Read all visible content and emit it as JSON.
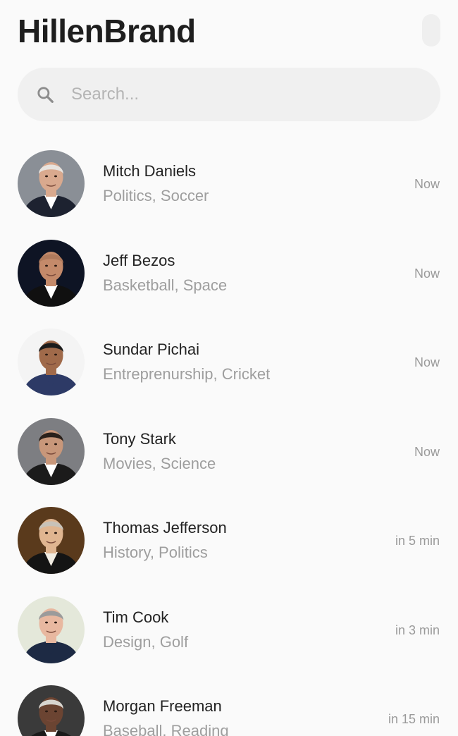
{
  "app": {
    "title": "HillenBrand"
  },
  "search": {
    "placeholder": "Search...",
    "icon": "search-icon"
  },
  "contacts": [
    {
      "name": "Mitch Daniels",
      "tags": "Politics, Soccer",
      "time": "Now",
      "avatar": {
        "bg": "#8a8f96",
        "skin": "#d9a98e",
        "hair": "#e8e3de",
        "shirt": "#ffffff",
        "suit": "#1d2230"
      }
    },
    {
      "name": "Jeff Bezos",
      "tags": "Basketball, Space",
      "time": "Now",
      "avatar": {
        "bg": "#0e1424",
        "skin": "#c48a6a",
        "hair": "#b07a5c",
        "shirt": "#ffffff",
        "suit": "#101010"
      }
    },
    {
      "name": "Sundar Pichai",
      "tags": "Entreprenurship, Cricket",
      "time": "Now",
      "avatar": {
        "bg": "#f4f4f4",
        "skin": "#a06a4a",
        "hair": "#1c1c1c",
        "shirt": "#2d3a66",
        "suit": "#2d3a66"
      }
    },
    {
      "name": "Tony Stark",
      "tags": "Movies, Science",
      "time": "Now",
      "avatar": {
        "bg": "#7d7e82",
        "skin": "#c8977a",
        "hair": "#2a211b",
        "shirt": "#ffffff",
        "suit": "#1b1b1b"
      }
    },
    {
      "name": "Thomas Jefferson",
      "tags": "History, Politics",
      "time": "in 5 min",
      "avatar": {
        "bg": "#5a3a1c",
        "skin": "#e0b590",
        "hair": "#c8c2b8",
        "shirt": "#f1ece2",
        "suit": "#141414"
      }
    },
    {
      "name": "Tim Cook",
      "tags": "Design, Golf",
      "time": "in 3 min",
      "avatar": {
        "bg": "#e4e8da",
        "skin": "#e8b8a0",
        "hair": "#9b9b9b",
        "shirt": "#1d2a44",
        "suit": "#1d2a44"
      }
    },
    {
      "name": "Morgan Freeman",
      "tags": "Baseball, Reading",
      "time": "in 15 min",
      "avatar": {
        "bg": "#3a3a3a",
        "skin": "#6b4432",
        "hair": "#d9d6d0",
        "shirt": "#ffffff",
        "suit": "#1a1a1a"
      }
    }
  ]
}
